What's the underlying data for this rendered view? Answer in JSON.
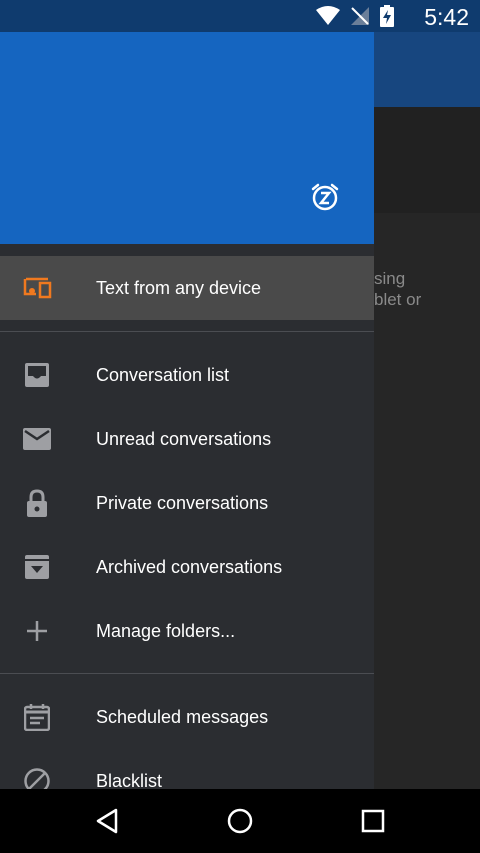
{
  "status_bar": {
    "time": "5:42",
    "icons": [
      "wifi-icon",
      "no-signal-icon",
      "battery-charging-icon"
    ]
  },
  "background": {
    "partial_text": "sing\nblet or"
  },
  "drawer": {
    "header_icon": "snooze-icon",
    "active_item": {
      "label": "Text from any device",
      "icon": "devices-icon"
    },
    "items": [
      {
        "label": "Conversation list",
        "icon": "inbox-icon"
      },
      {
        "label": "Unread conversations",
        "icon": "mail-icon"
      },
      {
        "label": "Private conversations",
        "icon": "lock-icon"
      },
      {
        "label": "Archived conversations",
        "icon": "archive-icon"
      },
      {
        "label": "Manage folders...",
        "icon": "add-icon"
      }
    ],
    "bottom_items": [
      {
        "label": "Scheduled messages",
        "icon": "calendar-note-icon"
      },
      {
        "label": "Blacklist",
        "icon": "block-icon"
      }
    ]
  },
  "colors": {
    "accent": "#1565c0",
    "status_bar": "#0f3b6e",
    "drawer_bg": "#2b2d31",
    "active_icon": "#f0791f"
  }
}
